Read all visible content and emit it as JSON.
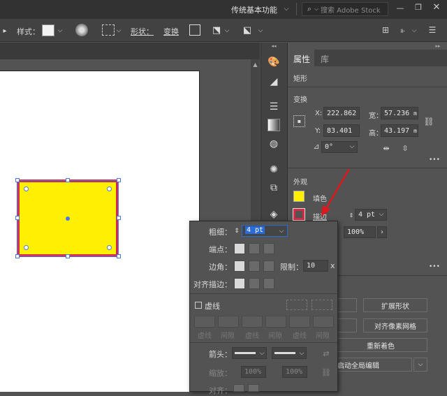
{
  "menubar": {
    "workspace": "传统基本功能",
    "search_placeholder": "搜索 Adobe Stock"
  },
  "control": {
    "style_label": "样式：",
    "shape_label": "形状：",
    "transform_label": "变换"
  },
  "panel": {
    "tab_properties": "属性",
    "tab_library": "库",
    "section_rect": "矩形",
    "section_transform": "变换",
    "x_label": "X:",
    "x_value": "222.862",
    "w_label": "宽：",
    "w_value": "57.236",
    "unit": "m",
    "y_label": "Y:",
    "y_value": "83.401",
    "h_label": "高：",
    "h_value": "43.197",
    "angle_value": "0°",
    "section_appearance": "外观",
    "fill_label": "填色",
    "stroke_label": "描边",
    "stroke_weight": "4 pt",
    "opacity": "100%",
    "expand_shape": "扩展形状",
    "align_pixel": "对齐像素网格",
    "recolor": "重新着色",
    "global_edit": "启动全局编辑",
    "more": "•••"
  },
  "stroke_popup": {
    "weight_label": "粗细：",
    "weight_value": "4 pt",
    "cap_label": "端点：",
    "corner_label": "边角：",
    "limit_label": "限制：",
    "limit_value": "10",
    "limit_unit": "x",
    "align_label": "对齐描边：",
    "dashed_label": "虚线",
    "dash_labels": [
      "虚线",
      "间隙",
      "虚线",
      "间隙",
      "虚线",
      "间隙"
    ],
    "arrow_label": "箭头：",
    "scale_label": "缩放：",
    "scale_1": "100%",
    "scale_2": "100%",
    "align2_label": "对齐："
  },
  "colors": {
    "fill": "#ffef00",
    "stroke": "#d62b45",
    "selection": "#4a78e0"
  }
}
